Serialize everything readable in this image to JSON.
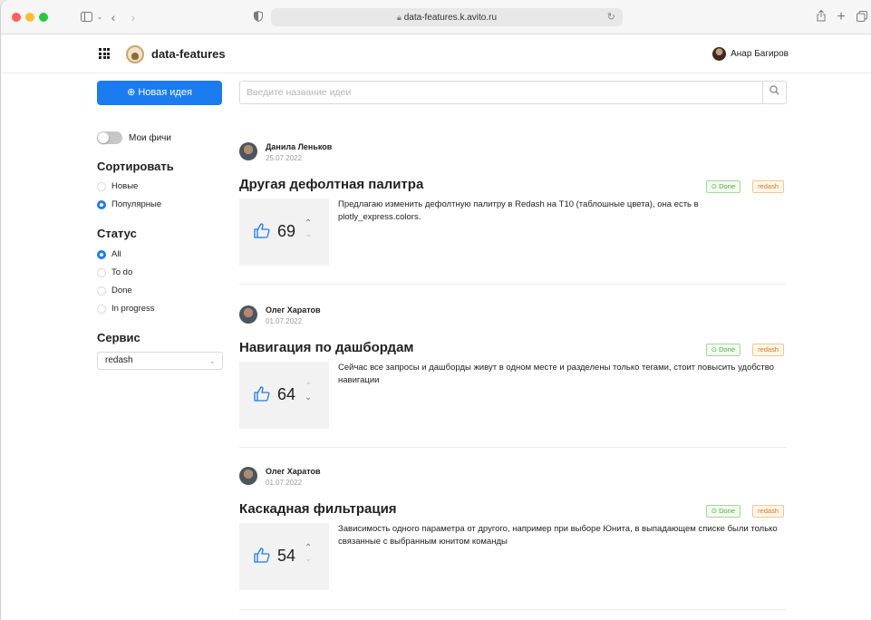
{
  "browser": {
    "url": "data-features.k.avito.ru"
  },
  "header": {
    "app_title": "data-features",
    "user_name": "Анар Багиров"
  },
  "sidebar": {
    "new_idea_label": "⊕ Новая идея",
    "my_features_label": "Мои фичи",
    "sort_heading": "Сортировать",
    "sort_options": [
      "Новые",
      "Популярные"
    ],
    "sort_selected": "Популярные",
    "status_heading": "Статус",
    "status_options": [
      "All",
      "To do",
      "Done",
      "In progress"
    ],
    "status_selected": "All",
    "service_heading": "Сервис",
    "service_value": "redash"
  },
  "search": {
    "placeholder": "Введите название идеи"
  },
  "ideas": [
    {
      "author": "Данила Леньков",
      "date": "25.07.2022",
      "title": "Другая дефолтная палитра",
      "status": "Done",
      "service": "redash",
      "votes": "69",
      "description": "Предлагаю изменить дефолтную палитру в Redash на T10 (таблошные цвета), она есть в plotly_express.colors."
    },
    {
      "author": "Олег Харатов",
      "date": "01.07.2022",
      "title": "Навигация по дашбордам",
      "status": "Done",
      "service": "redash",
      "votes": "64",
      "description": "Сейчас все запросы и дашборды живут в одном месте и разделены только тегами, стоит повысить удобство навигации"
    },
    {
      "author": "Олег Харатов",
      "date": "01.07.2022",
      "title": "Каскадная фильтрация",
      "status": "Done",
      "service": "redash",
      "votes": "54",
      "description": "Зависимость одного параметра от другого, например при выборе Юнита, в выпадающем списке были только связанные с выбранным юнитом команды"
    }
  ]
}
